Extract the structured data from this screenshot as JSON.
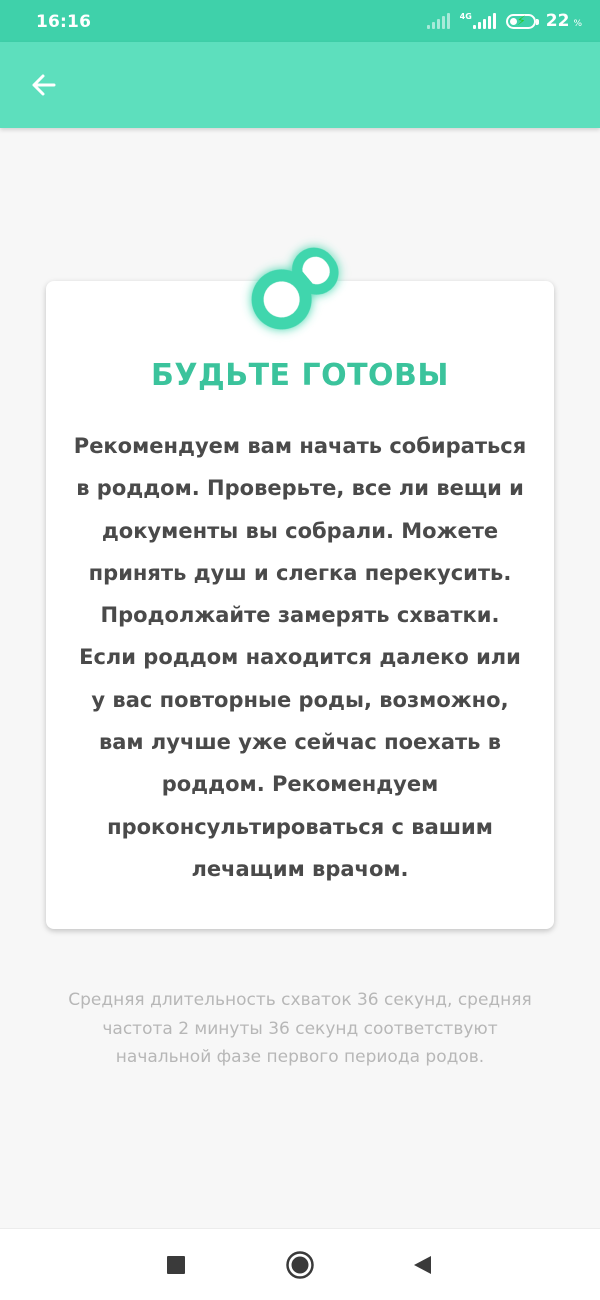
{
  "status_bar": {
    "time": "16:16",
    "network_label": "4G",
    "battery_level": "22",
    "battery_unit": "%"
  },
  "app_bar": {
    "back_icon": "arrow-left-icon"
  },
  "card": {
    "icon": "pacifier-icon",
    "title": "БУДЬТЕ ГОТОВЫ",
    "body": "Рекомендуем вам начать собираться в роддом. Проверьте, все ли вещи и документы вы собрали. Можете принять душ и слегка перекусить. Продолжайте замерять схватки. Если роддом находится далеко или у вас повторные роды, возможно, вам лучше уже сейчас поехать в роддом. Рекомендуем проконсультироваться с вашим лечащим врачом."
  },
  "summary": "Средняя длительность схваток 36 секунд, средняя частота 2 минуты 36 секунд соответствуют начальной фазе первого периода родов.",
  "nav_bar": {
    "recents_icon": "square-icon",
    "home_icon": "circle-icon",
    "back_icon": "triangle-back-icon"
  },
  "colors": {
    "status_bar": "#3fd1aa",
    "app_bar": "#5ddfbd",
    "accent": "#3bc39c",
    "body_text": "#4a4a4a",
    "muted_text": "#b7b7b7"
  }
}
